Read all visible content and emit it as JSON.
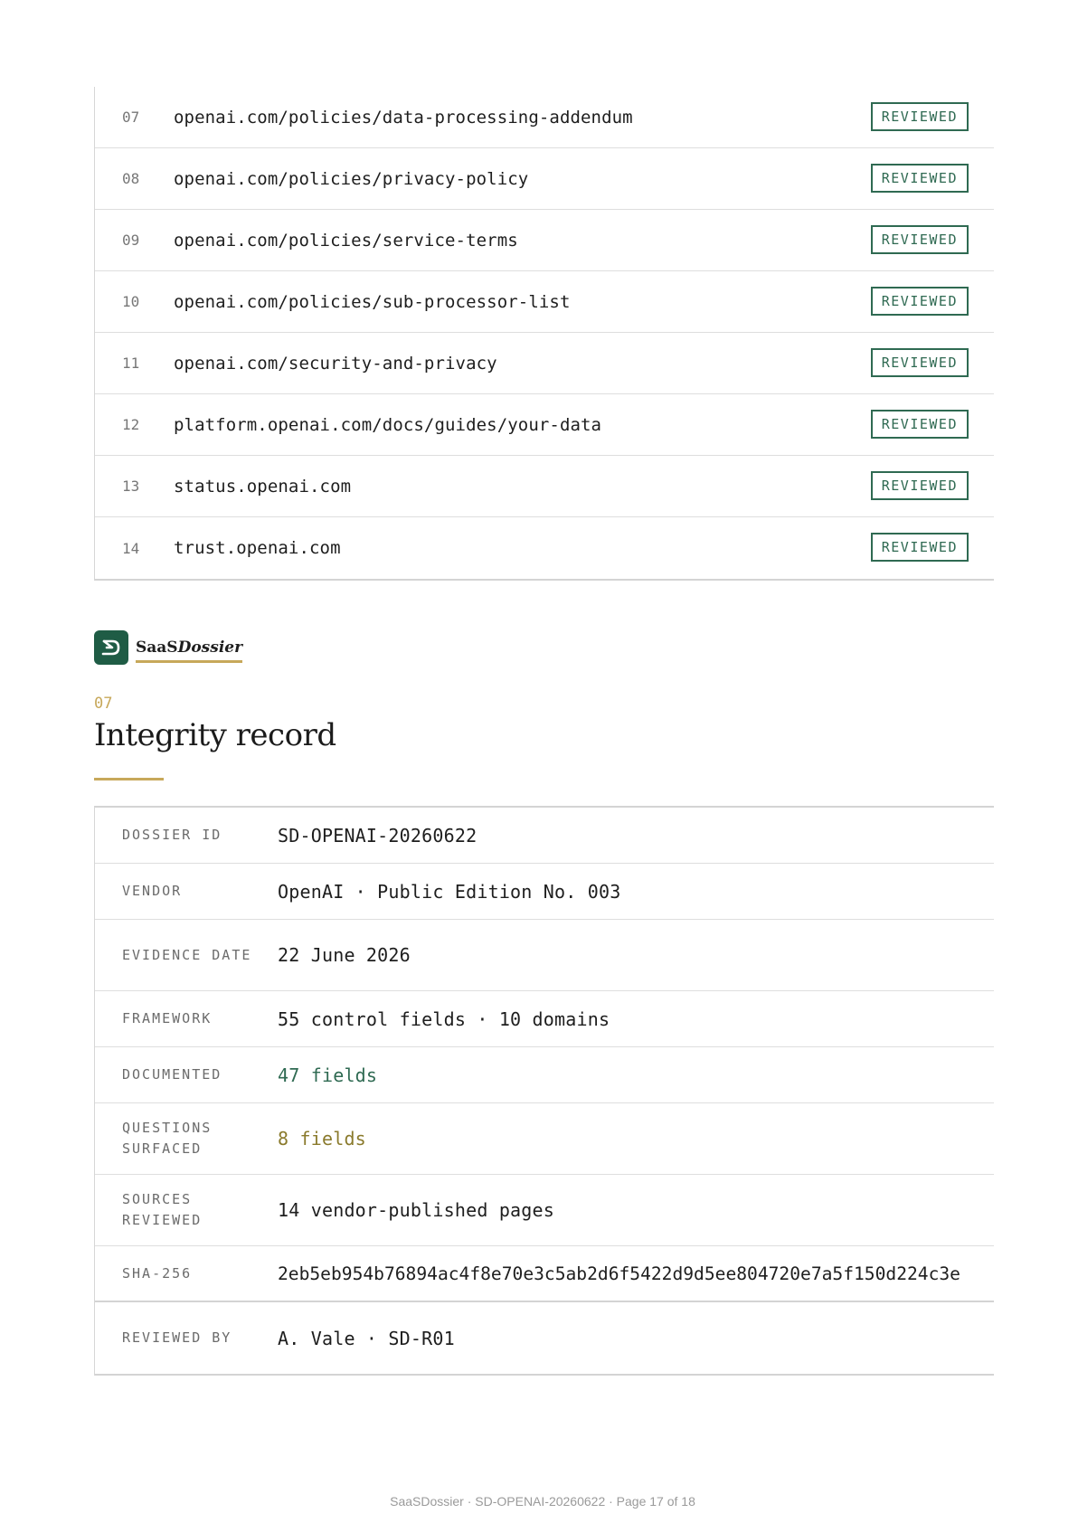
{
  "sources": [
    {
      "num": "07",
      "url": "openai.com/policies/data-processing-addendum",
      "status": "REVIEWED"
    },
    {
      "num": "08",
      "url": "openai.com/policies/privacy-policy",
      "status": "REVIEWED"
    },
    {
      "num": "09",
      "url": "openai.com/policies/service-terms",
      "status": "REVIEWED"
    },
    {
      "num": "10",
      "url": "openai.com/policies/sub-processor-list",
      "status": "REVIEWED"
    },
    {
      "num": "11",
      "url": "openai.com/security-and-privacy",
      "status": "REVIEWED"
    },
    {
      "num": "12",
      "url": "platform.openai.com/docs/guides/your-data",
      "status": "REVIEWED"
    },
    {
      "num": "13",
      "url": "status.openai.com",
      "status": "REVIEWED"
    },
    {
      "num": "14",
      "url": "trust.openai.com",
      "status": "REVIEWED"
    }
  ],
  "brand": {
    "name_plain": "SaaS",
    "name_italic": "Dossier"
  },
  "section": {
    "number": "07",
    "title": "Integrity record"
  },
  "record": [
    {
      "key": "DOSSIER ID",
      "value": "SD-OPENAI-20260622"
    },
    {
      "key": "VENDOR",
      "value": "OpenAI · Public Edition No. 003"
    },
    {
      "key": "EVIDENCE DATE",
      "value": "22 June 2026"
    },
    {
      "key": "FRAMEWORK",
      "value": "55 control fields · 10 domains"
    },
    {
      "key": "DOCUMENTED",
      "value": "47 fields"
    },
    {
      "key": "QUESTIONS SURFACED",
      "value": "8 fields"
    },
    {
      "key": "SOURCES REVIEWED",
      "value": "14 vendor-published pages"
    },
    {
      "key": "SHA-256",
      "value": "2eb5eb954b76894ac4f8e70e3c5ab2d6f5422d9d5ee804720e7a5f150d224c3e"
    },
    {
      "key": "REVIEWED BY",
      "value": "A. Vale · SD-R01"
    }
  ],
  "colors": {
    "documented": "#2f6a52",
    "questions": "#8a7a2c",
    "accent": "#c7a85a",
    "brand": "#1f5c45"
  },
  "footer": "SaaSDossier · SD-OPENAI-20260622 · Page 17 of 18"
}
